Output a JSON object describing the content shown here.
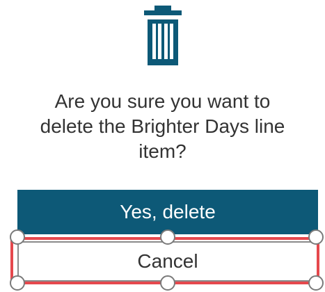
{
  "dialog": {
    "icon": "trash-icon",
    "question": "Are you sure you want to delete the Brighter Days line item?",
    "confirm_label": "Yes, delete",
    "cancel_label": "Cancel"
  },
  "colors": {
    "accent": "#0d5977",
    "selection": "#e5484d",
    "text": "#333333"
  },
  "selection": {
    "selected_element": "cancel-button",
    "handles": [
      "top-left",
      "top-center",
      "top-right",
      "bottom-left",
      "bottom-center",
      "bottom-right"
    ]
  }
}
